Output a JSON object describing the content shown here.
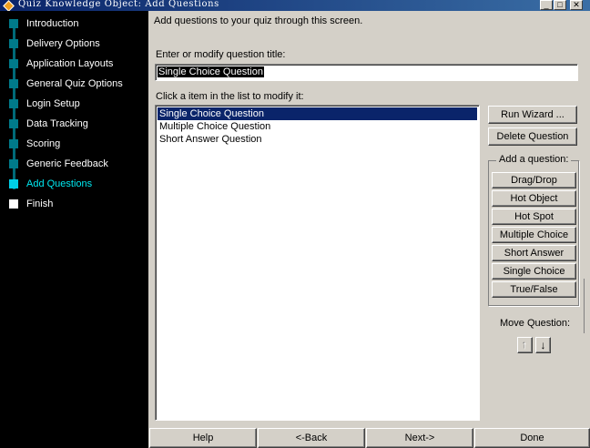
{
  "window": {
    "title": "Quiz Knowledge Object: Add Questions",
    "controls": {
      "minimize": "_",
      "maximize": "□",
      "close": "✕"
    }
  },
  "nav": {
    "items": [
      {
        "label": "Introduction",
        "state": "done"
      },
      {
        "label": "Delivery Options",
        "state": "done"
      },
      {
        "label": "Application Layouts",
        "state": "done"
      },
      {
        "label": "General Quiz Options",
        "state": "done"
      },
      {
        "label": "Login Setup",
        "state": "done"
      },
      {
        "label": "Data Tracking",
        "state": "done"
      },
      {
        "label": "Scoring",
        "state": "done"
      },
      {
        "label": "Generic Feedback",
        "state": "done"
      },
      {
        "label": "Add Questions",
        "state": "active"
      },
      {
        "label": "Finish",
        "state": "pending"
      }
    ]
  },
  "main": {
    "instruction": "Add questions to your quiz through this screen.",
    "title_label": "Enter or modify question title:",
    "title_value": "Single Choice Question",
    "list_label": "Click a item in the list to modify it:",
    "questions": [
      {
        "label": "Single Choice Question",
        "selected": true
      },
      {
        "label": "Multiple Choice Question",
        "selected": false
      },
      {
        "label": "Short Answer Question",
        "selected": false
      }
    ]
  },
  "actions": {
    "run_wizard": "Run Wizard ...",
    "delete_question": "Delete Question",
    "add_group_title": "Add a question:",
    "add_buttons": [
      "Drag/Drop",
      "Hot Object",
      "Hot Spot",
      "Multiple Choice",
      "Short Answer",
      "Single Choice",
      "True/False"
    ],
    "move_label": "Move Question:",
    "move_up": "↑",
    "move_down": "↓"
  },
  "footer": {
    "help": "Help",
    "back": "<-Back",
    "next": "Next->",
    "done": "Done"
  },
  "colors": {
    "title_bar": "#0a246a",
    "nav_background": "#000000",
    "nav_marker": "#007a8a",
    "nav_active": "#00d0e8",
    "selection": "#0a246a",
    "face": "#d4d0c8"
  }
}
